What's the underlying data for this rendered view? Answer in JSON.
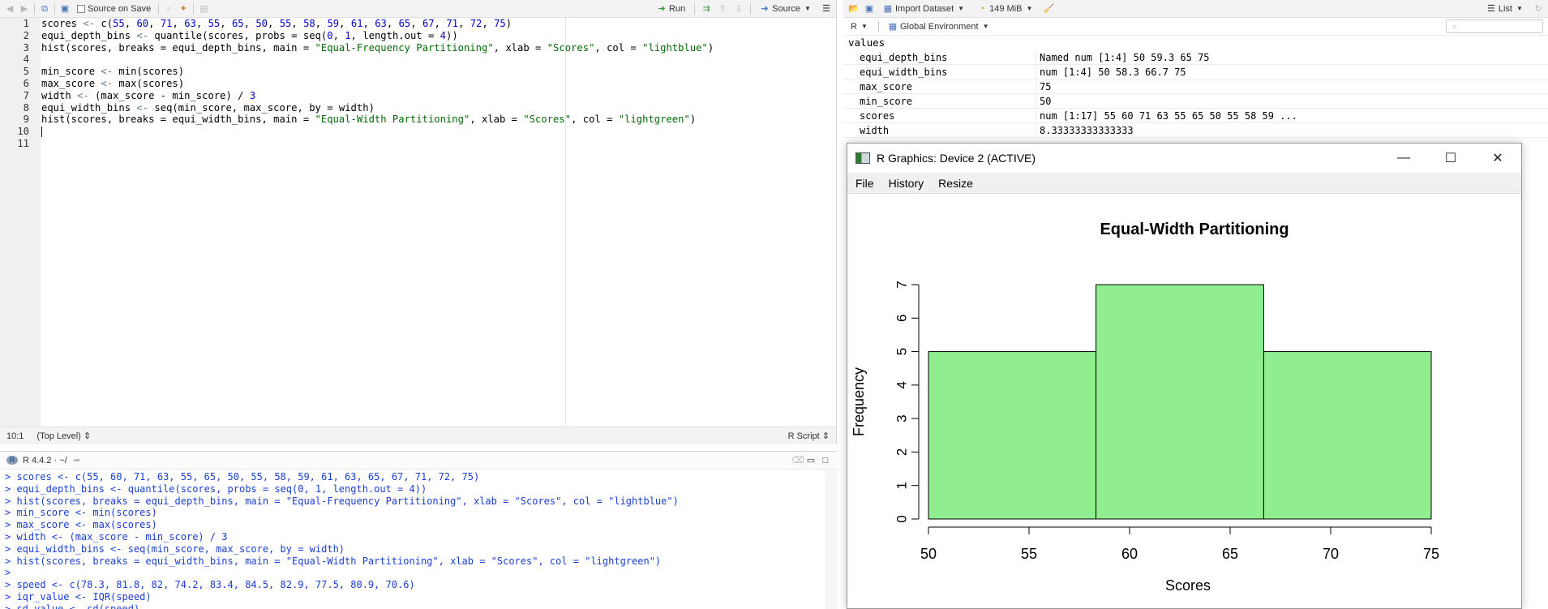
{
  "editor": {
    "toolbar": {
      "source_on_save": "Source on Save",
      "run": "Run",
      "source": "Source"
    },
    "lines": [
      [
        [
          "id",
          "scores "
        ],
        [
          "op",
          "<- "
        ],
        [
          "id",
          "c("
        ],
        [
          "num",
          "55"
        ],
        [
          "id",
          ", "
        ],
        [
          "num",
          "60"
        ],
        [
          "id",
          ", "
        ],
        [
          "num",
          "71"
        ],
        [
          "id",
          ", "
        ],
        [
          "num",
          "63"
        ],
        [
          "id",
          ", "
        ],
        [
          "num",
          "55"
        ],
        [
          "id",
          ", "
        ],
        [
          "num",
          "65"
        ],
        [
          "id",
          ", "
        ],
        [
          "num",
          "50"
        ],
        [
          "id",
          ", "
        ],
        [
          "num",
          "55"
        ],
        [
          "id",
          ", "
        ],
        [
          "num",
          "58"
        ],
        [
          "id",
          ", "
        ],
        [
          "num",
          "59"
        ],
        [
          "id",
          ", "
        ],
        [
          "num",
          "61"
        ],
        [
          "id",
          ", "
        ],
        [
          "num",
          "63"
        ],
        [
          "id",
          ", "
        ],
        [
          "num",
          "65"
        ],
        [
          "id",
          ", "
        ],
        [
          "num",
          "67"
        ],
        [
          "id",
          ", "
        ],
        [
          "num",
          "71"
        ],
        [
          "id",
          ", "
        ],
        [
          "num",
          "72"
        ],
        [
          "id",
          ", "
        ],
        [
          "num",
          "75"
        ],
        [
          "id",
          ")"
        ]
      ],
      [
        [
          "id",
          "equi_depth_bins "
        ],
        [
          "op",
          "<- "
        ],
        [
          "id",
          "quantile(scores, probs = seq("
        ],
        [
          "num",
          "0"
        ],
        [
          "id",
          ", "
        ],
        [
          "num",
          "1"
        ],
        [
          "id",
          ", length.out = "
        ],
        [
          "num",
          "4"
        ],
        [
          "id",
          "))"
        ]
      ],
      [
        [
          "id",
          "hist(scores, breaks = equi_depth_bins, main = "
        ],
        [
          "str",
          "\"Equal-Frequency Partitioning\""
        ],
        [
          "id",
          ", xlab = "
        ],
        [
          "str",
          "\"Scores\""
        ],
        [
          "id",
          ", col = "
        ],
        [
          "str",
          "\"lightblue\""
        ],
        [
          "id",
          ")"
        ]
      ],
      [],
      [
        [
          "id",
          "min_score "
        ],
        [
          "op",
          "<- "
        ],
        [
          "id",
          "min(scores)"
        ]
      ],
      [
        [
          "id",
          "max_score "
        ],
        [
          "op",
          "<- "
        ],
        [
          "id",
          "max(scores)"
        ]
      ],
      [
        [
          "id",
          "width "
        ],
        [
          "op",
          "<- "
        ],
        [
          "id",
          "(max_score - min_score) / "
        ],
        [
          "num",
          "3"
        ]
      ],
      [
        [
          "id",
          "equi_width_bins "
        ],
        [
          "op",
          "<- "
        ],
        [
          "id",
          "seq(min_score, max_score, by = width)"
        ]
      ],
      [
        [
          "id",
          "hist(scores, breaks = equi_width_bins, main = "
        ],
        [
          "str",
          "\"Equal-Width Partitioning\""
        ],
        [
          "id",
          ", xlab = "
        ],
        [
          "str",
          "\"Scores\""
        ],
        [
          "id",
          ", col = "
        ],
        [
          "str",
          "\"lightgreen\""
        ],
        [
          "id",
          ")"
        ]
      ],
      [],
      []
    ],
    "status": {
      "position": "10:1",
      "scope": "(Top Level)",
      "type": "R Script"
    }
  },
  "console": {
    "header": "R 4.4.2 · ~/",
    "lines": [
      "> scores <- c(55, 60, 71, 63, 55, 65, 50, 55, 58, 59, 61, 63, 65, 67, 71, 72, 75)",
      "> equi_depth_bins <- quantile(scores, probs = seq(0, 1, length.out = 4))",
      "> hist(scores, breaks = equi_depth_bins, main = \"Equal-Frequency Partitioning\", xlab = \"Scores\", col = \"lightblue\")",
      "> min_score <- min(scores)",
      "> max_score <- max(scores)",
      "> width <- (max_score - min_score) / 3",
      "> equi_width_bins <- seq(min_score, max_score, by = width)",
      "> hist(scores, breaks = equi_width_bins, main = \"Equal-Width Partitioning\", xlab = \"Scores\", col = \"lightgreen\")",
      ">",
      "> speed <- c(78.3, 81.8, 82, 74.2, 83.4, 84.5, 82.9, 77.5, 80.9, 70.6)",
      "> iqr_value <- IQR(speed)",
      "> sd_value <- sd(speed)"
    ]
  },
  "environment": {
    "toolbar": {
      "import": "Import Dataset",
      "memory": "149 MiB",
      "view": "List"
    },
    "language": "R",
    "scope": "Global Environment",
    "section": "values",
    "rows": [
      {
        "name": "equi_depth_bins",
        "value": "Named num [1:4] 50 59.3 65 75"
      },
      {
        "name": "equi_width_bins",
        "value": "num [1:4] 50 58.3 66.7 75"
      },
      {
        "name": "max_score",
        "value": "75"
      },
      {
        "name": "min_score",
        "value": "50"
      },
      {
        "name": "scores",
        "value": "num [1:17] 55 60 71 63 55 65 50 55 58 59 ..."
      },
      {
        "name": "width",
        "value": "8.33333333333333"
      }
    ]
  },
  "graphics": {
    "title": "R Graphics: Device 2 (ACTIVE)",
    "menu": [
      "File",
      "History",
      "Resize"
    ]
  },
  "chart_data": {
    "type": "bar",
    "title": "Equal-Width Partitioning",
    "xlabel": "Scores",
    "ylabel": "Frequency",
    "bins": [
      {
        "x0": 50,
        "x1": 58.33,
        "count": 5
      },
      {
        "x0": 58.33,
        "x1": 66.67,
        "count": 7
      },
      {
        "x0": 66.67,
        "x1": 75,
        "count": 5
      }
    ],
    "xticks": [
      50,
      55,
      60,
      65,
      70,
      75
    ],
    "yticks": [
      0,
      1,
      2,
      3,
      4,
      5,
      6,
      7
    ],
    "xlim": [
      50,
      75
    ],
    "ylim": [
      0,
      7
    ],
    "bar_color": "#90ee90"
  }
}
